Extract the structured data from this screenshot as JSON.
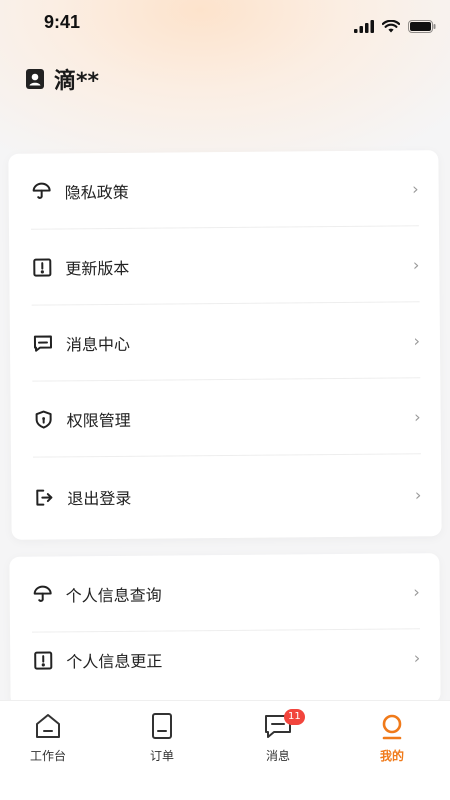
{
  "status_bar": {
    "time": "9:41"
  },
  "header": {
    "user_name": "滴**",
    "icon": "user-card-icon"
  },
  "menu_primary": [
    {
      "label": "隐私政策",
      "icon": "umbrella-icon"
    },
    {
      "label": "更新版本",
      "icon": "alert-square-icon"
    },
    {
      "label": "消息中心",
      "icon": "message-square-icon"
    },
    {
      "label": "权限管理",
      "icon": "shield-icon"
    },
    {
      "label": "退出登录",
      "icon": "logout-icon"
    }
  ],
  "menu_secondary": [
    {
      "label": "个人信息查询",
      "icon": "umbrella-icon"
    },
    {
      "label": "个人信息更正",
      "icon": "alert-square-icon"
    }
  ],
  "chevron": "›",
  "tabbar": {
    "items": [
      {
        "label": "工作台",
        "icon": "home-icon"
      },
      {
        "label": "订单",
        "icon": "order-icon"
      },
      {
        "label": "消息",
        "icon": "message-icon",
        "badge": "11"
      },
      {
        "label": "我的",
        "icon": "profile-icon",
        "active": true
      }
    ],
    "active_color": "#f07a1a",
    "badge_color": "#f2453d"
  }
}
